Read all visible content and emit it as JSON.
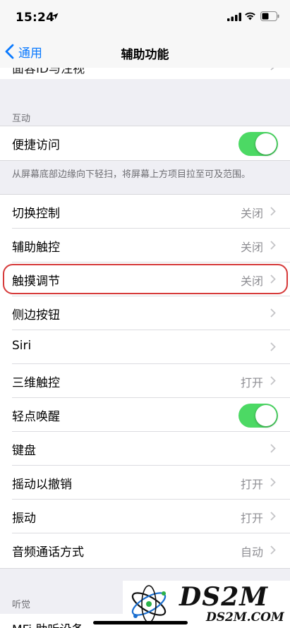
{
  "status": {
    "time": "15:24"
  },
  "nav": {
    "back_label": "通用",
    "title": "辅助功能"
  },
  "partial_top_row": {
    "label": "面容ID与注视"
  },
  "sections": {
    "interaction_header": "互动",
    "interaction_footer": "从屏幕底部边缘向下轻扫，将屏幕上方项目拉至可及范围。",
    "hearing_header": "听觉"
  },
  "reachability": {
    "label": "便捷访问",
    "on": true
  },
  "rows": [
    {
      "label": "切换控制",
      "value": "关闭"
    },
    {
      "label": "辅助触控",
      "value": "关闭"
    },
    {
      "label": "触摸调节",
      "value": "关闭"
    },
    {
      "label": "侧边按钮",
      "value": ""
    },
    {
      "label": "Siri",
      "value": ""
    },
    {
      "label": "三维触控",
      "value": "打开"
    },
    {
      "label": "轻点唤醒",
      "value": "",
      "toggle_on": true
    },
    {
      "label": "键盘",
      "value": ""
    },
    {
      "label": "摇动以撤销",
      "value": "打开"
    },
    {
      "label": "振动",
      "value": "打开"
    },
    {
      "label": "音频通话方式",
      "value": "自动"
    }
  ],
  "bottom_partial_row": {
    "label": "MFi 助听设备"
  },
  "watermark": {
    "title": "DS2M",
    "subtitle": "DS2M.COM"
  },
  "colors": {
    "accent": "#0a7aff",
    "toggle_on": "#4cd964",
    "highlight": "#d63a3a"
  }
}
